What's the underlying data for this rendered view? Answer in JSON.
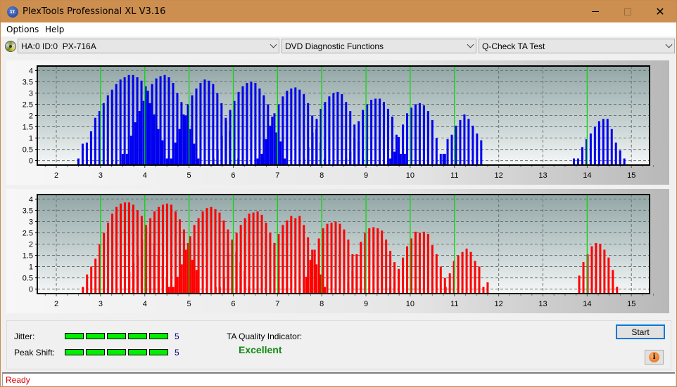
{
  "window": {
    "title": "PlexTools Professional XL V3.16",
    "app_icon": "xl-logo-icon",
    "controls": [
      "minimize-icon",
      "maximize-icon",
      "close-icon"
    ]
  },
  "menu": {
    "items": [
      "Options",
      "Help"
    ]
  },
  "toolbar": {
    "drive_icon": "disc-drive-icon",
    "drive_select": "HA:0 ID:0  PX-716A",
    "function_select": "DVD Diagnostic Functions",
    "test_select": "Q-Check TA Test"
  },
  "results": {
    "jitter_label": "Jitter:",
    "jitter_value": "5",
    "jitter_level": 5,
    "jitter_max": 5,
    "peak_shift_label": "Peak Shift:",
    "peak_shift_value": "5",
    "peak_shift_level": 5,
    "peak_shift_max": 5,
    "ta_quality_label": "TA Quality Indicator:",
    "ta_quality_value": "Excellent"
  },
  "buttons": {
    "start": "Start",
    "info_icon": "info-icon"
  },
  "status": {
    "text": "Ready"
  },
  "colors": {
    "titlebar": "#cd8f4f",
    "top_bars": "#0000ee",
    "bottom_bars": "#ff0000",
    "reference_lines": "#00dd00",
    "meter_fill": "#00ee00",
    "quality_text": "#108a10",
    "status_text": "#e00000"
  },
  "chart_data": [
    {
      "type": "bar",
      "name": "top-chart",
      "series_color": "#0000ee",
      "xlim": [
        1.57,
        15.41
      ],
      "ylim": [
        -0.2,
        4.2
      ],
      "x_ticks": [
        "2",
        "3",
        "4",
        "5",
        "6",
        "7",
        "8",
        "9",
        "10",
        "11",
        "12",
        "13",
        "14",
        "15"
      ],
      "y_ticks": [
        "0",
        "0.5",
        "1",
        "1.5",
        "2",
        "2.5",
        "3",
        "3.5",
        "4"
      ],
      "grid": true,
      "reference_lines": [
        3,
        4,
        5,
        6,
        7,
        8,
        9,
        10,
        11,
        14
      ],
      "clusters": [
        {
          "start": 2.5,
          "values": [
            0.0,
            0.75,
            0.8,
            1.3,
            1.9,
            2.2,
            2.55,
            2.9,
            3.15,
            3.4,
            3.6,
            3.7,
            3.8,
            3.8,
            3.7,
            3.55,
            3.3,
            2.55,
            2.05,
            1.4,
            0.9
          ]
        },
        {
          "start": 3.5,
          "values": [
            0.3,
            0.3,
            1.1,
            1.7,
            2.2,
            2.65,
            3.1,
            3.4,
            3.65,
            3.75,
            3.8,
            3.7,
            3.45,
            3.0,
            2.6,
            2.0,
            1.4,
            0.75,
            0.0
          ]
        },
        {
          "start": 4.5,
          "values": [
            0.0,
            0.0,
            0.8,
            1.4,
            2.05,
            2.5,
            2.9,
            3.2,
            3.45,
            3.6,
            3.55,
            3.4,
            3.0,
            2.55,
            1.9,
            1.3,
            0.85,
            0.0
          ]
        },
        {
          "start": 5.55,
          "values": [
            0.0,
            0.5,
            1.1,
            1.75,
            2.25,
            2.65,
            3.05,
            3.3,
            3.45,
            3.5,
            3.45,
            3.2,
            2.9,
            2.5,
            1.95,
            1.25,
            0.85,
            0.0
          ]
        },
        {
          "start": 6.55,
          "values": [
            0.0,
            0.3,
            0.95,
            1.55,
            2.1,
            2.5,
            2.85,
            3.1,
            3.2,
            3.25,
            3.15,
            2.95,
            2.55,
            2.0,
            1.4,
            0.8,
            0.0
          ]
        },
        {
          "start": 7.6,
          "values": [
            0.0,
            0.6,
            1.25,
            1.85,
            2.3,
            2.6,
            2.85,
            3.0,
            3.05,
            2.95,
            2.6,
            2.2,
            1.6,
            0.85,
            0.0
          ]
        },
        {
          "start": 8.55,
          "values": [
            0.0,
            0.4,
            1.0,
            1.75,
            2.25,
            2.5,
            2.7,
            2.75,
            2.75,
            2.6,
            2.3,
            1.95,
            1.15,
            0.3,
            0.3
          ]
        },
        {
          "start": 9.55,
          "values": [
            0.0,
            0.4,
            1.05,
            1.6,
            2.1,
            2.35,
            2.5,
            2.55,
            2.45,
            2.2,
            1.8,
            1.0,
            0.3,
            0.3
          ]
        },
        {
          "start": 10.75,
          "values": [
            0.3,
            0.95,
            1.15,
            1.55,
            1.8,
            2.05,
            1.85,
            1.55,
            1.2,
            0.9
          ]
        },
        {
          "start": 13.7,
          "values": [
            0.0,
            0.0,
            0.6,
            0.95,
            1.2,
            1.5,
            1.75,
            1.85,
            1.85,
            1.4,
            0.8,
            0.45,
            0.0
          ]
        }
      ]
    },
    {
      "type": "bar",
      "name": "bottom-chart",
      "series_color": "#ff0000",
      "xlim": [
        1.57,
        15.41
      ],
      "ylim": [
        -0.2,
        4.2
      ],
      "x_ticks": [
        "2",
        "3",
        "4",
        "5",
        "6",
        "7",
        "8",
        "9",
        "10",
        "11",
        "12",
        "13",
        "14",
        "15"
      ],
      "y_ticks": [
        "0",
        "0.5",
        "1",
        "1.5",
        "2",
        "2.5",
        "3",
        "3.5",
        "4"
      ],
      "grid": true,
      "reference_lines": [
        3,
        4,
        5,
        6,
        7,
        8,
        9,
        10,
        11,
        14
      ],
      "clusters": [
        {
          "start": 2.6,
          "values": [
            0.0,
            0.65,
            1.0,
            1.35,
            2.0,
            2.5,
            2.95,
            3.35,
            3.65,
            3.8,
            3.85,
            3.85,
            3.75,
            3.5,
            3.25,
            2.85,
            2.45,
            2.0,
            1.5,
            1.0,
            0.5
          ]
        },
        {
          "start": 3.65,
          "values": [
            0.75,
            1.15,
            1.5,
            2.2,
            2.75,
            3.15,
            3.45,
            3.65,
            3.75,
            3.8,
            3.75,
            3.45,
            3.1,
            2.65,
            2.05,
            1.3,
            0.85
          ]
        },
        {
          "start": 4.55,
          "values": [
            0.0,
            0.0,
            0.55,
            1.1,
            1.75,
            2.35,
            2.85,
            3.15,
            3.45,
            3.6,
            3.65,
            3.55,
            3.4,
            3.05,
            2.65,
            2.2,
            1.65,
            1.2,
            0.8,
            0.0
          ]
        },
        {
          "start": 5.6,
          "values": [
            0.0,
            0.0,
            0.5,
            1.6,
            2.0,
            2.5,
            2.85,
            3.15,
            3.35,
            3.4,
            3.45,
            3.3,
            2.95,
            2.5,
            2.05,
            1.0,
            0.5,
            0.0
          ]
        },
        {
          "start": 6.55,
          "values": [
            0.0,
            0.3,
            0.65,
            1.65,
            2.05,
            2.45,
            2.85,
            3.05,
            3.25,
            3.15,
            3.25,
            2.85,
            2.3,
            1.75,
            1.1,
            0.65,
            0.0
          ]
        },
        {
          "start": 7.65,
          "values": [
            0.55,
            1.3,
            1.75,
            2.25,
            2.7,
            2.9,
            2.95,
            3.0,
            2.9,
            2.65,
            2.2,
            1.55,
            0.85,
            0.0
          ]
        },
        {
          "start": 8.6,
          "values": [
            0.3,
            0.8,
            1.55,
            2.1,
            2.5,
            2.7,
            2.75,
            2.7,
            2.6,
            2.2,
            1.7,
            1.2,
            0.9,
            0.0
          ]
        },
        {
          "start": 9.55,
          "values": [
            0.0,
            0.35,
            0.85,
            1.4,
            1.9,
            2.25,
            2.55,
            2.5,
            2.55,
            2.45,
            1.95,
            1.55,
            1.0,
            0.5
          ]
        },
        {
          "start": 10.8,
          "values": [
            0.0,
            0.7,
            1.25,
            1.5,
            1.65,
            1.8,
            1.65,
            1.25,
            1.0,
            0.0,
            0.3
          ]
        },
        {
          "start": 13.82,
          "values": [
            0.6,
            1.2,
            1.55,
            1.9,
            2.05,
            2.0,
            1.75,
            1.4,
            0.85,
            0.1
          ]
        }
      ]
    }
  ]
}
